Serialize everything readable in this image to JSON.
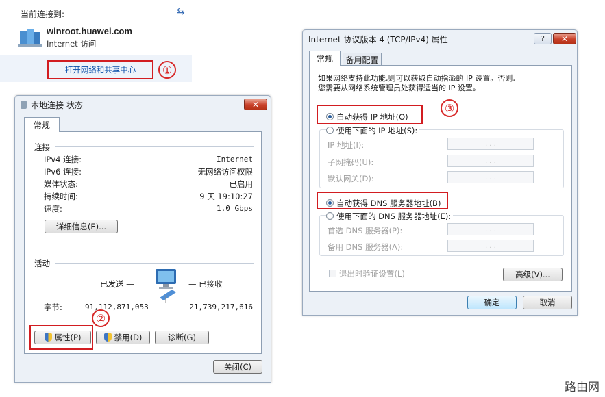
{
  "network_flyout": {
    "current_label": "当前连接到:",
    "network_name": "winroot.huawei.com",
    "access": "Internet 访问",
    "open_center_link": "打开网络和共享中心",
    "step1": "①"
  },
  "status_window": {
    "title": "本地连接 状态",
    "close_x": "✕",
    "tab": "常规",
    "connection_header": "连接",
    "rows": [
      {
        "label": "IPv4 连接:",
        "value": "Internet"
      },
      {
        "label": "IPv6 连接:",
        "value": "无网络访问权限"
      },
      {
        "label": "媒体状态:",
        "value": "已启用"
      },
      {
        "label": "持续时间:",
        "value": "9 天 19:10:27"
      },
      {
        "label": "速度:",
        "value": "1.0 Gbps"
      }
    ],
    "details_button": "详细信息(E)...",
    "activity_header": "活动",
    "sent_label": "已发送 —",
    "recv_label": "— 已接收",
    "bytes_label": "字节:",
    "bytes_sent": "91,112,871,053",
    "bytes_recv": "21,739,217,616",
    "properties_button": "属性(P)",
    "disable_button": "禁用(D)",
    "diagnose_button": "诊断(G)",
    "close_button": "关闭(C)",
    "step2": "②"
  },
  "ipv4_window": {
    "title": "Internet 协议版本 4 (TCP/IPv4) 属性",
    "help": "?",
    "close_x": "✕",
    "tab_general": "常规",
    "tab_alt": "备用配置",
    "description_line1": "如果网络支持此功能,则可以获取自动指派的 IP 设置。否则,",
    "description_line2": "您需要从网络系统管理员处获得适当的 IP 设置。",
    "auto_ip": "自动获得 IP 地址(O)",
    "manual_ip": "使用下面的 IP 地址(S):",
    "ip_address": "IP 地址(I):",
    "subnet_mask": "子网掩码(U):",
    "gateway": "默认网关(D):",
    "auto_dns": "自动获得 DNS 服务器地址(B)",
    "manual_dns": "使用下面的 DNS 服务器地址(E):",
    "preferred_dns": "首选 DNS 服务器(P):",
    "alternate_dns": "备用 DNS 服务器(A):",
    "validate_on_exit": "退出时验证设置(L)",
    "advanced_button": "高级(V)...",
    "ok_button": "确定",
    "cancel_button": "取消",
    "ip_dots": ".  .  .",
    "step3": "③"
  },
  "watermark": "路由网",
  "colors": {
    "highlight": "#d21d21",
    "link": "#0a4ea8"
  }
}
